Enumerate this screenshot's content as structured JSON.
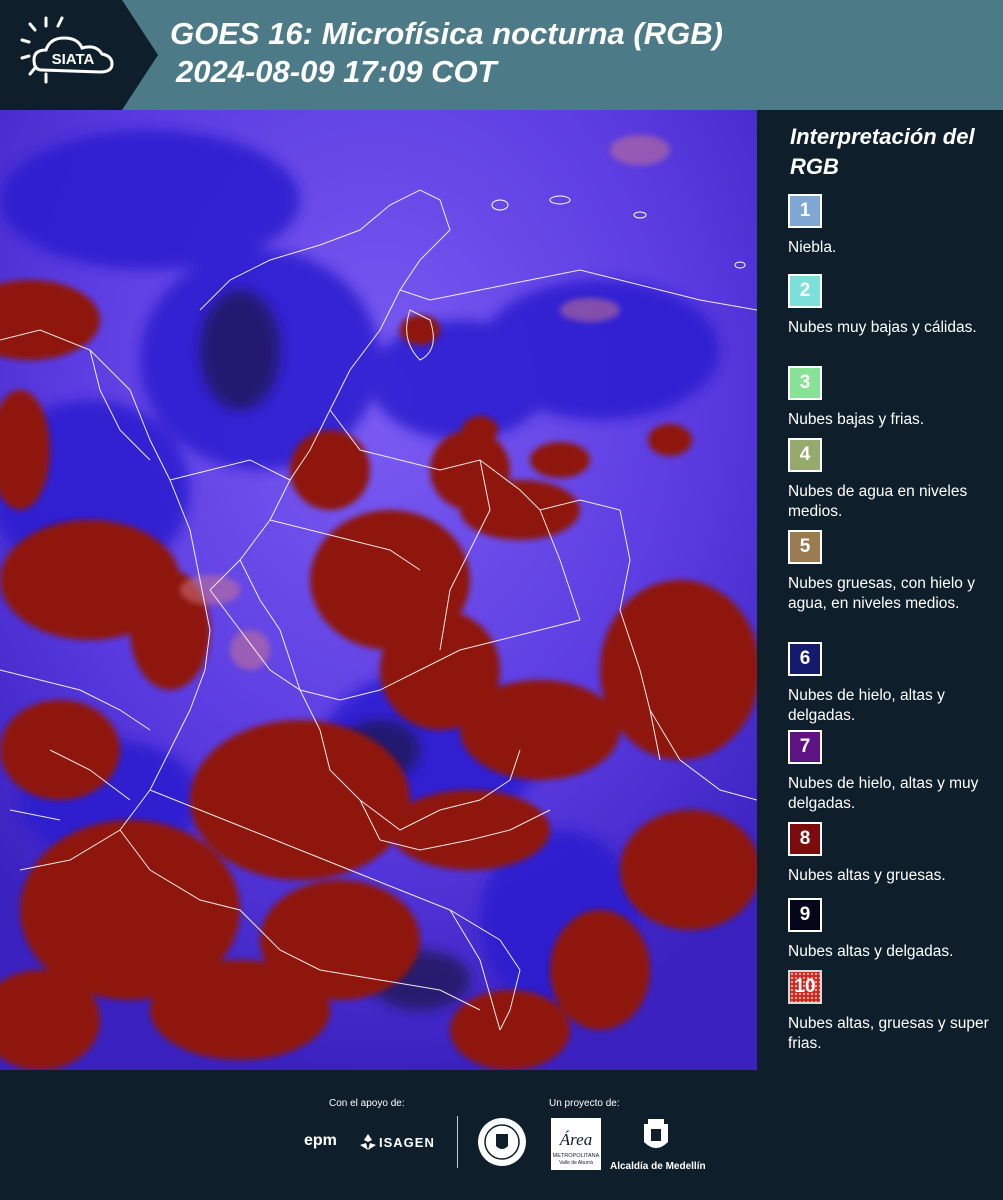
{
  "header": {
    "logo_text": "SIATA",
    "title_line1": "GOES 16: Microfísica nocturna (RGB)",
    "title_line2": "2024-08-09 17:09 COT"
  },
  "legend": {
    "title": "Interpretación del RGB",
    "items": [
      {
        "number": "1",
        "color": "#7fa7d4",
        "description": "Niebla."
      },
      {
        "number": "2",
        "color": "#7ce0d8",
        "description": "Nubes muy bajas y cálidas."
      },
      {
        "number": "3",
        "color": "#88e296",
        "description": "Nubes bajas y frias."
      },
      {
        "number": "4",
        "color": "#97aa6e",
        "description": "Nubes de agua en niveles medios."
      },
      {
        "number": "5",
        "color": "#9a7b52",
        "description": "Nubes gruesas, con hielo y agua, en niveles medios."
      },
      {
        "number": "6",
        "color": "#141a6e",
        "description": "Nubes de hielo, altas y delgadas."
      },
      {
        "number": "7",
        "color": "#5d1482",
        "description": "Nubes de hielo, altas y muy delgadas."
      },
      {
        "number": "8",
        "color": "#7c0c0c",
        "description": "Nubes altas y gruesas."
      },
      {
        "number": "9",
        "color": "#06061a",
        "description": "Nubes altas y delgadas."
      },
      {
        "number": "10",
        "color": "#c8241c",
        "description": "Nubes altas, gruesas y super frias."
      }
    ]
  },
  "footer": {
    "support_label": "Con el apoyo de:",
    "project_label": "Un proyecto de:",
    "sponsor_epm": "epm",
    "sponsor_isagen": "ISAGEN",
    "area_logo_text": "Área",
    "area_sub_line1": "METROPOLITANA",
    "area_sub_line2": "Valle de Aburrá",
    "alcaldia_label": "Alcaldía de Medellín"
  },
  "colors": {
    "background": "#0e1f2b",
    "header_band": "#4d7a87",
    "map_base": "#4e2fd8",
    "cloud_red": "#8e1510",
    "border_lines": "#ffffff"
  }
}
